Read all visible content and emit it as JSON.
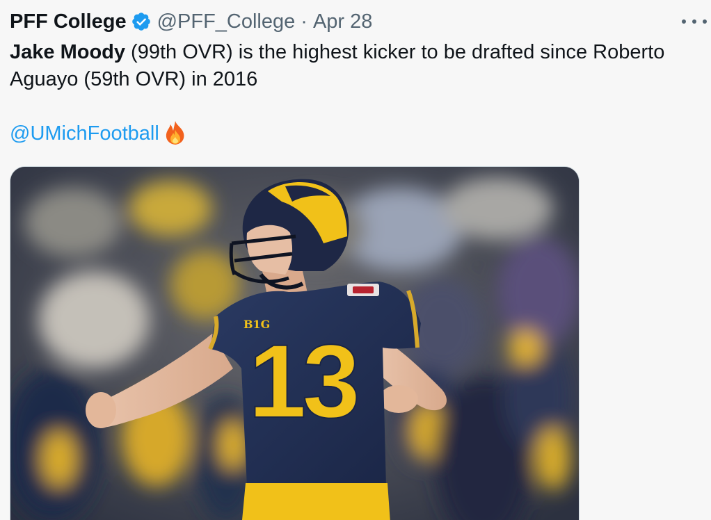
{
  "tweet": {
    "author_name": "PFF College",
    "handle": "@PFF_College",
    "separator": "·",
    "date": "Apr 28",
    "verified_icon": "verified-badge-icon",
    "more_icon": "more-options-icon",
    "text": {
      "bold_name": "Jake Moody",
      "line1_rest": " (99th OVR) is the highest kicker to be drafted since Roberto",
      "line2": "Aguayo (59th OVR) in 2016",
      "mention": "@UMichFootball",
      "emoji": "fire-emoji-icon"
    },
    "media": {
      "jersey_number": "13",
      "conference_patch": "B1G"
    }
  },
  "colors": {
    "link": "#1d9bf0",
    "verified": "#1d9bf0",
    "secondary_text": "#536471",
    "jersey_navy": "#1f2d4e",
    "maize": "#f4c21a"
  }
}
